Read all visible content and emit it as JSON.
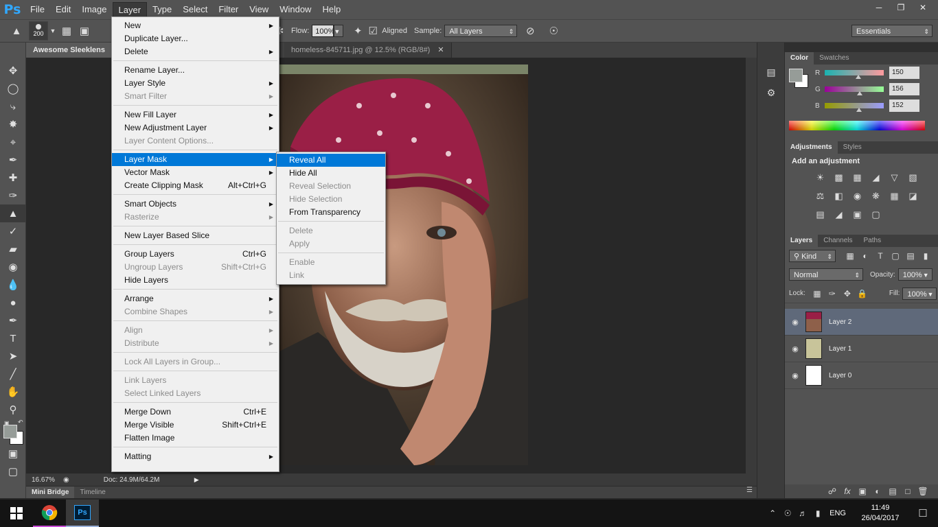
{
  "menubar": {
    "logo": "Ps",
    "items": [
      "File",
      "Edit",
      "Image",
      "Layer",
      "Type",
      "Select",
      "Filter",
      "View",
      "Window",
      "Help"
    ]
  },
  "options": {
    "brush_size": "200",
    "flow_label": "Flow:",
    "flow_value": "100%",
    "aligned_label": "Aligned",
    "sample_label": "Sample:",
    "sample_value": "All Layers",
    "workspace": "Essentials"
  },
  "tabs": {
    "doc1": "Awesome Sleeklens L",
    "doc2": "homeless-845711.jpg @ 12.5% (RGB/8#)"
  },
  "status": {
    "zoom": "16.67%",
    "doc_size": "Doc: 24.9M/64.2M"
  },
  "bottom_tabs": [
    "Mini Bridge",
    "Timeline"
  ],
  "color_panel": {
    "tabs": [
      "Color",
      "Swatches"
    ],
    "r_label": "R",
    "r_value": "150",
    "g_label": "G",
    "g_value": "156",
    "b_label": "B",
    "b_value": "152"
  },
  "adjustments": {
    "tabs": [
      "Adjustments",
      "Styles"
    ],
    "title": "Add an adjustment"
  },
  "layers_panel": {
    "tabs": [
      "Layers",
      "Channels",
      "Paths"
    ],
    "filter": "Kind",
    "blend_mode": "Normal",
    "opacity_label": "Opacity:",
    "opacity_value": "100%",
    "lock_label": "Lock:",
    "fill_label": "Fill:",
    "fill_value": "100%",
    "layers": [
      "Layer 2",
      "Layer 1",
      "Layer 0"
    ]
  },
  "layer_menu": {
    "new": "New",
    "duplicate": "Duplicate Layer...",
    "delete": "Delete",
    "rename": "Rename Layer...",
    "layer_style": "Layer Style",
    "smart_filter": "Smart Filter",
    "new_fill": "New Fill Layer",
    "new_adjustment": "New Adjustment Layer",
    "layer_content_options": "Layer Content Options...",
    "layer_mask": "Layer Mask",
    "vector_mask": "Vector Mask",
    "clipping_mask": "Create Clipping Mask",
    "clipping_mask_sc": "Alt+Ctrl+G",
    "smart_objects": "Smart Objects",
    "rasterize": "Rasterize",
    "new_slice": "New Layer Based Slice",
    "group": "Group Layers",
    "group_sc": "Ctrl+G",
    "ungroup": "Ungroup Layers",
    "ungroup_sc": "Shift+Ctrl+G",
    "hide": "Hide Layers",
    "arrange": "Arrange",
    "combine": "Combine Shapes",
    "align": "Align",
    "distribute": "Distribute",
    "lock_all": "Lock All Layers in Group...",
    "link": "Link Layers",
    "select_linked": "Select Linked Layers",
    "merge_down": "Merge Down",
    "merge_down_sc": "Ctrl+E",
    "merge_visible": "Merge Visible",
    "merge_visible_sc": "Shift+Ctrl+E",
    "flatten": "Flatten Image",
    "matting": "Matting"
  },
  "mask_submenu": {
    "reveal_all": "Reveal All",
    "hide_all": "Hide All",
    "reveal_selection": "Reveal Selection",
    "hide_selection": "Hide Selection",
    "from_transparency": "From Transparency",
    "delete": "Delete",
    "apply": "Apply",
    "enable": "Enable",
    "link": "Link"
  },
  "taskbar": {
    "language": "ENG",
    "time": "11:49",
    "date": "26/04/2017"
  }
}
